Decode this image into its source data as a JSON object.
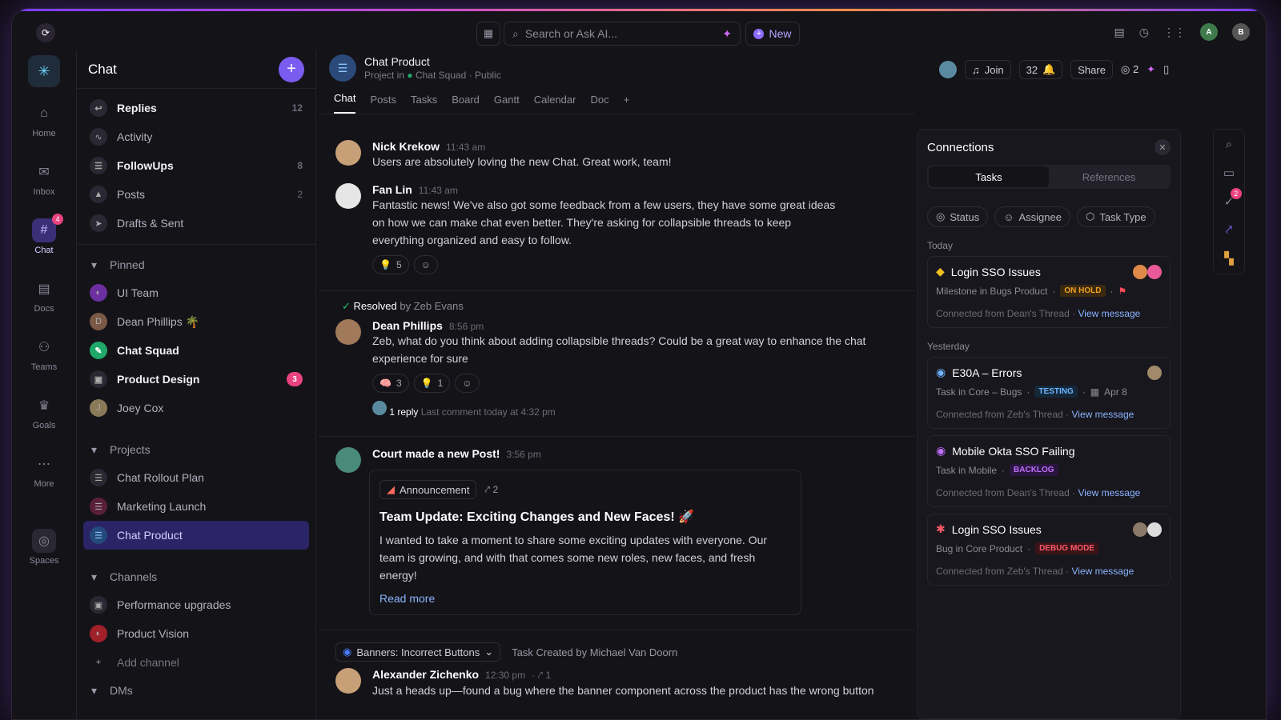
{
  "topbar": {
    "search_placeholder": "Search or Ask AI...",
    "new_label": "New"
  },
  "rail": [
    {
      "label": "Home",
      "icon": "home-icon"
    },
    {
      "label": "Inbox",
      "icon": "inbox-icon"
    },
    {
      "label": "Chat",
      "icon": "chat-icon",
      "badge": "4"
    },
    {
      "label": "Docs",
      "icon": "docs-icon"
    },
    {
      "label": "Teams",
      "icon": "teams-icon"
    },
    {
      "label": "Goals",
      "icon": "goals-icon"
    },
    {
      "label": "More",
      "icon": "more-icon"
    },
    {
      "label": "Spaces",
      "icon": "spaces-icon"
    }
  ],
  "sidebar": {
    "title": "Chat",
    "top": [
      {
        "label": "Replies",
        "count": "12"
      },
      {
        "label": "Activity",
        "count": ""
      },
      {
        "label": "FollowUps",
        "count": "8"
      },
      {
        "label": "Posts",
        "count": "2"
      },
      {
        "label": "Drafts & Sent",
        "count": ""
      }
    ],
    "pinned_label": "Pinned",
    "pinned": [
      "UI Team",
      "Dean Phillips 🌴",
      "Chat Squad",
      "Product Design",
      "Joey Cox"
    ],
    "pinned_badge": "3",
    "projects_label": "Projects",
    "projects": [
      "Chat Rollout Plan",
      "Marketing Launch",
      "Chat Product"
    ],
    "channels_label": "Channels",
    "channels": [
      "Performance upgrades",
      "Product Vision",
      "Add channel"
    ],
    "dms_label": "DMs"
  },
  "header": {
    "title": "Chat Product",
    "sub_prefix": "Project in",
    "sub_space": "Chat Squad",
    "sub_visibility": "Public",
    "join": "Join",
    "count": "32",
    "share": "Share",
    "watchers": "2"
  },
  "tabs": [
    "Chat",
    "Posts",
    "Tasks",
    "Board",
    "Gantt",
    "Calendar",
    "Doc"
  ],
  "messages": {
    "m1": {
      "name": "Nick Krekow",
      "time": "11:43 am",
      "text": "Users are absolutely loving the new Chat. Great work, team!"
    },
    "m2": {
      "name": "Fan Lin",
      "time": "11:43 am",
      "text": "Fantastic news! We've also got some feedback from a few users, they have some great ideas on how we can make chat even better. They're asking for collapsible threads to keep everything organized and easy to follow.",
      "reaction": "5"
    },
    "resolved": {
      "label": "Resolved",
      "by": "by Zeb Evans"
    },
    "m3": {
      "name": "Dean Phillips",
      "time": "8:56 pm",
      "text": "Zeb, what do you think about adding collapsible threads? Could be a great way to enhance the chat experience for sure",
      "r1": "3",
      "r2": "1",
      "reply": "1 reply",
      "last": "Last comment today at 4:32 pm"
    },
    "m4": {
      "name": "Court made a new Post!",
      "time": "3:56 pm",
      "chip": "Announcement",
      "chip_count": "2",
      "title": "Team Update: Exciting Changes and New Faces! 🚀",
      "body": "I wanted to take a moment to share some exciting updates with everyone. Our team is growing, and with that comes some new roles, new faces, and fresh energy!",
      "read_more": "Read more"
    },
    "task": {
      "label": "Banners: Incorrect Buttons",
      "created": "Task Created by Michael Van Doorn"
    },
    "m5": {
      "name": "Alexander Zichenko",
      "time": "12:30 pm",
      "count": "1",
      "text": "Just a heads up—found a bug where the banner component across the product has the wrong button"
    }
  },
  "connections": {
    "title": "Connections",
    "tab_tasks": "Tasks",
    "tab_refs": "References",
    "filters": [
      "Status",
      "Assignee",
      "Task Type"
    ],
    "today": "Today",
    "yesterday": "Yesterday",
    "cards": [
      {
        "title": "Login SSO Issues",
        "sub": "Milestone in Bugs Product",
        "tag": "ON HOLD",
        "tag_color": "#f0a020",
        "from": "Connected from Dean's Thread",
        "link": "View message"
      },
      {
        "title": "E30A – Errors",
        "sub": "Task in Core – Bugs",
        "tag": "TESTING",
        "tag_color": "#6fb5ff",
        "date": "Apr 8",
        "from": "Connected from Zeb's Thread",
        "link": "View message"
      },
      {
        "title": "Mobile Okta SSO Failing",
        "sub": "Task in Mobile",
        "tag": "BACKLOG",
        "tag_color": "#c070ff",
        "from": "Connected from Dean's Thread",
        "link": "View message"
      },
      {
        "title": "Login SSO Issues",
        "sub": "Bug in Core Product",
        "tag": "DEBUG MODE",
        "tag_color": "#ff5a6a",
        "from": "Connected from Zeb's Thread",
        "link": "View message"
      }
    ]
  },
  "right_rail_badge": "2"
}
